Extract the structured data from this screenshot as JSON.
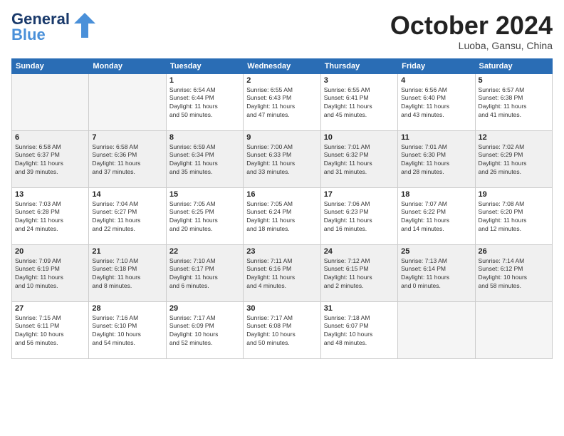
{
  "logo": {
    "part1": "General",
    "part2": "Blue"
  },
  "header": {
    "month": "October 2024",
    "location": "Luoba, Gansu, China"
  },
  "weekdays": [
    "Sunday",
    "Monday",
    "Tuesday",
    "Wednesday",
    "Thursday",
    "Friday",
    "Saturday"
  ],
  "weeks": [
    [
      {
        "day": "",
        "info": ""
      },
      {
        "day": "",
        "info": ""
      },
      {
        "day": "1",
        "info": "Sunrise: 6:54 AM\nSunset: 6:44 PM\nDaylight: 11 hours\nand 50 minutes."
      },
      {
        "day": "2",
        "info": "Sunrise: 6:55 AM\nSunset: 6:43 PM\nDaylight: 11 hours\nand 47 minutes."
      },
      {
        "day": "3",
        "info": "Sunrise: 6:55 AM\nSunset: 6:41 PM\nDaylight: 11 hours\nand 45 minutes."
      },
      {
        "day": "4",
        "info": "Sunrise: 6:56 AM\nSunset: 6:40 PM\nDaylight: 11 hours\nand 43 minutes."
      },
      {
        "day": "5",
        "info": "Sunrise: 6:57 AM\nSunset: 6:38 PM\nDaylight: 11 hours\nand 41 minutes."
      }
    ],
    [
      {
        "day": "6",
        "info": "Sunrise: 6:58 AM\nSunset: 6:37 PM\nDaylight: 11 hours\nand 39 minutes."
      },
      {
        "day": "7",
        "info": "Sunrise: 6:58 AM\nSunset: 6:36 PM\nDaylight: 11 hours\nand 37 minutes."
      },
      {
        "day": "8",
        "info": "Sunrise: 6:59 AM\nSunset: 6:34 PM\nDaylight: 11 hours\nand 35 minutes."
      },
      {
        "day": "9",
        "info": "Sunrise: 7:00 AM\nSunset: 6:33 PM\nDaylight: 11 hours\nand 33 minutes."
      },
      {
        "day": "10",
        "info": "Sunrise: 7:01 AM\nSunset: 6:32 PM\nDaylight: 11 hours\nand 31 minutes."
      },
      {
        "day": "11",
        "info": "Sunrise: 7:01 AM\nSunset: 6:30 PM\nDaylight: 11 hours\nand 28 minutes."
      },
      {
        "day": "12",
        "info": "Sunrise: 7:02 AM\nSunset: 6:29 PM\nDaylight: 11 hours\nand 26 minutes."
      }
    ],
    [
      {
        "day": "13",
        "info": "Sunrise: 7:03 AM\nSunset: 6:28 PM\nDaylight: 11 hours\nand 24 minutes."
      },
      {
        "day": "14",
        "info": "Sunrise: 7:04 AM\nSunset: 6:27 PM\nDaylight: 11 hours\nand 22 minutes."
      },
      {
        "day": "15",
        "info": "Sunrise: 7:05 AM\nSunset: 6:25 PM\nDaylight: 11 hours\nand 20 minutes."
      },
      {
        "day": "16",
        "info": "Sunrise: 7:05 AM\nSunset: 6:24 PM\nDaylight: 11 hours\nand 18 minutes."
      },
      {
        "day": "17",
        "info": "Sunrise: 7:06 AM\nSunset: 6:23 PM\nDaylight: 11 hours\nand 16 minutes."
      },
      {
        "day": "18",
        "info": "Sunrise: 7:07 AM\nSunset: 6:22 PM\nDaylight: 11 hours\nand 14 minutes."
      },
      {
        "day": "19",
        "info": "Sunrise: 7:08 AM\nSunset: 6:20 PM\nDaylight: 11 hours\nand 12 minutes."
      }
    ],
    [
      {
        "day": "20",
        "info": "Sunrise: 7:09 AM\nSunset: 6:19 PM\nDaylight: 11 hours\nand 10 minutes."
      },
      {
        "day": "21",
        "info": "Sunrise: 7:10 AM\nSunset: 6:18 PM\nDaylight: 11 hours\nand 8 minutes."
      },
      {
        "day": "22",
        "info": "Sunrise: 7:10 AM\nSunset: 6:17 PM\nDaylight: 11 hours\nand 6 minutes."
      },
      {
        "day": "23",
        "info": "Sunrise: 7:11 AM\nSunset: 6:16 PM\nDaylight: 11 hours\nand 4 minutes."
      },
      {
        "day": "24",
        "info": "Sunrise: 7:12 AM\nSunset: 6:15 PM\nDaylight: 11 hours\nand 2 minutes."
      },
      {
        "day": "25",
        "info": "Sunrise: 7:13 AM\nSunset: 6:14 PM\nDaylight: 11 hours\nand 0 minutes."
      },
      {
        "day": "26",
        "info": "Sunrise: 7:14 AM\nSunset: 6:12 PM\nDaylight: 10 hours\nand 58 minutes."
      }
    ],
    [
      {
        "day": "27",
        "info": "Sunrise: 7:15 AM\nSunset: 6:11 PM\nDaylight: 10 hours\nand 56 minutes."
      },
      {
        "day": "28",
        "info": "Sunrise: 7:16 AM\nSunset: 6:10 PM\nDaylight: 10 hours\nand 54 minutes."
      },
      {
        "day": "29",
        "info": "Sunrise: 7:17 AM\nSunset: 6:09 PM\nDaylight: 10 hours\nand 52 minutes."
      },
      {
        "day": "30",
        "info": "Sunrise: 7:17 AM\nSunset: 6:08 PM\nDaylight: 10 hours\nand 50 minutes."
      },
      {
        "day": "31",
        "info": "Sunrise: 7:18 AM\nSunset: 6:07 PM\nDaylight: 10 hours\nand 48 minutes."
      },
      {
        "day": "",
        "info": ""
      },
      {
        "day": "",
        "info": ""
      }
    ]
  ]
}
